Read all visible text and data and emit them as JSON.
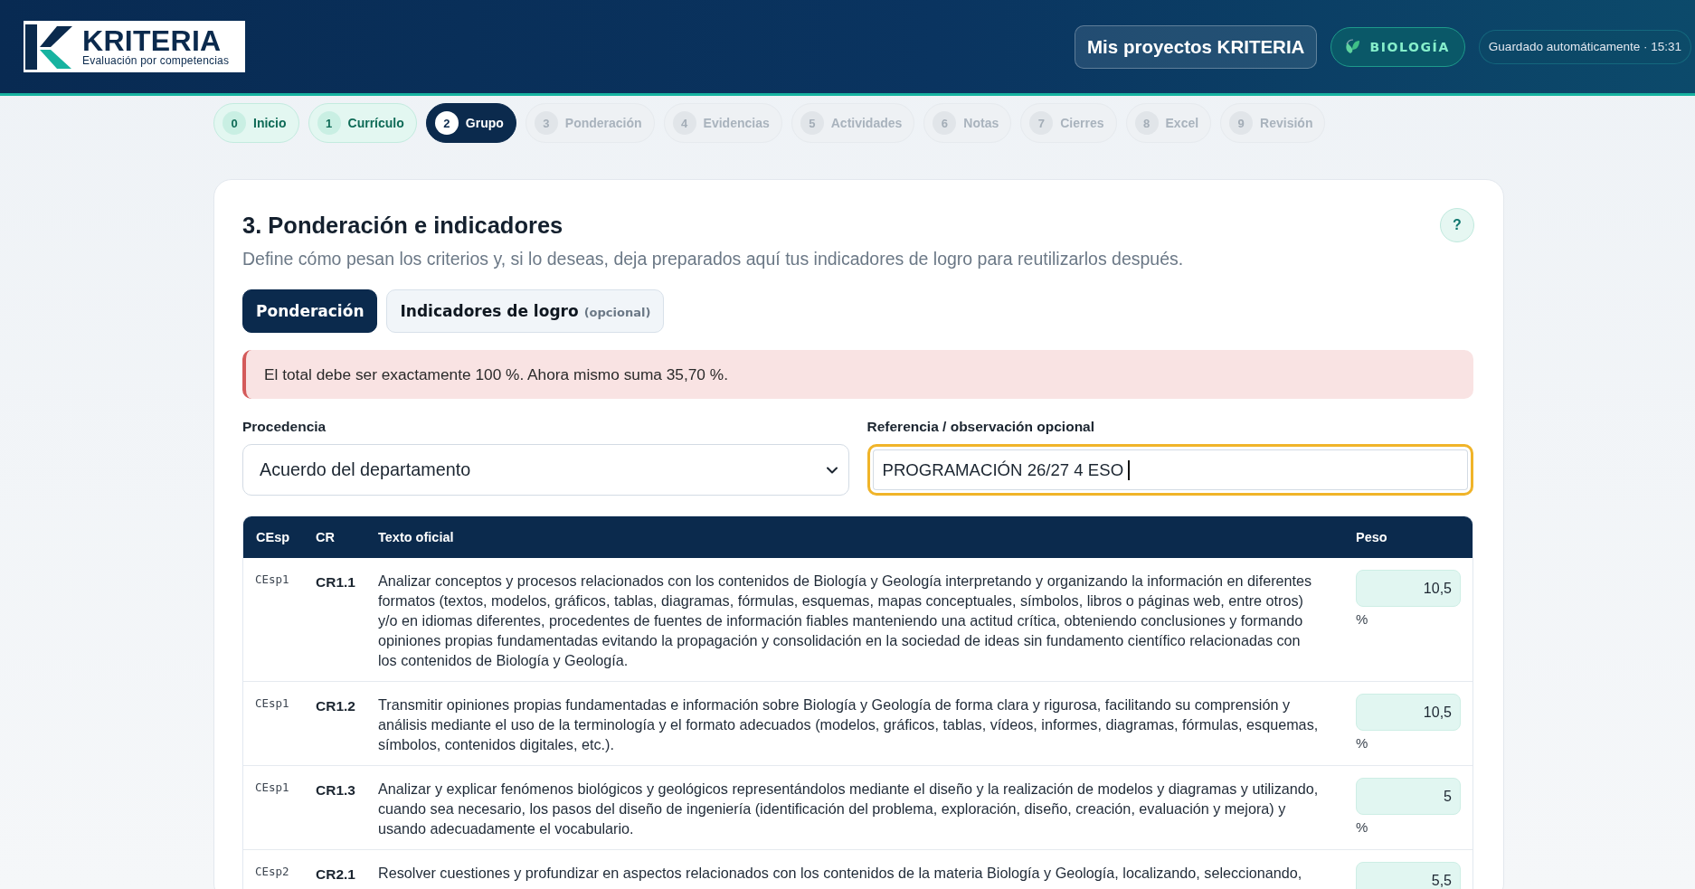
{
  "header": {
    "logo": {
      "wordmark": "KRITERIA",
      "tagline": "Evaluación por competencias"
    },
    "projects_button": "Mis proyectos KRITERIA",
    "subject_badge": "BIOLOGÍA",
    "autosave": "Guardado automáticamente · 15:31"
  },
  "stepper": [
    {
      "number": "0",
      "label": "Inicio",
      "completed": true,
      "selected": false
    },
    {
      "number": "1",
      "label": "Currículo",
      "completed": true,
      "selected": false
    },
    {
      "number": "2",
      "label": "Grupo",
      "completed": false,
      "selected": true
    },
    {
      "number": "3",
      "label": "Ponderación",
      "completed": false,
      "selected": false
    },
    {
      "number": "4",
      "label": "Evidencias",
      "completed": false,
      "selected": false
    },
    {
      "number": "5",
      "label": "Actividades",
      "completed": false,
      "selected": false
    },
    {
      "number": "6",
      "label": "Notas",
      "completed": false,
      "selected": false
    },
    {
      "number": "7",
      "label": "Cierres",
      "completed": false,
      "selected": false
    },
    {
      "number": "8",
      "label": "Excel",
      "completed": false,
      "selected": false
    },
    {
      "number": "9",
      "label": "Revisión",
      "completed": false,
      "selected": false
    }
  ],
  "section": {
    "title": "3. Ponderación e indicadores",
    "help_button": "?",
    "subtitle": "Define cómo pesan los criterios y, si lo deseas, deja preparados aquí tus indicadores de logro para reutilizarlos después.",
    "tabs": [
      {
        "label": "Ponderación",
        "selected": true
      },
      {
        "label": "Indicadores de logro",
        "note": "(opcional)",
        "selected": false
      }
    ],
    "alert": {
      "kind": "error",
      "text": "El total debe ser exactamente 100 %. Ahora mismo suma 35,70 %."
    },
    "fields": [
      {
        "kind": "select",
        "label": "Procedencia",
        "value": "Acuerdo del departamento",
        "focused": false
      },
      {
        "kind": "text",
        "label": "Referencia / observación opcional",
        "value": "PROGRAMACIÓN 26/27 4 ESO",
        "focused": true
      }
    ],
    "table": {
      "columns": [
        "CEsp",
        "CR",
        "Texto oficial",
        "Peso"
      ],
      "rows": [
        {
          "cesp": "CEsp1",
          "cr": "CR1.1",
          "text": "Analizar conceptos y procesos relacionados con los contenidos de Biología y Geología interpretando y organizando la información en diferentes formatos (textos, modelos, gráficos, tablas, diagramas, fórmulas, esquemas, mapas conceptuales, símbolos, libros o páginas web, entre otros) y/o en idiomas diferentes, procedentes de fuentes de información fiables manteniendo una actitud crítica, obteniendo conclusiones y formando opiniones propias fundamentadas evitando la propagación y consolidación en la sociedad de ideas sin fundamento científico relacionadas con los contenidos de Biología y Geología.",
          "weight": "10,5",
          "unit": "%"
        },
        {
          "cesp": "CEsp1",
          "cr": "CR1.2",
          "text": "Transmitir opiniones propias fundamentadas e información sobre Biología y Geología de forma clara y rigurosa, facilitando su comprensión y análisis mediante el uso de la terminología y el formato adecuados (modelos, gráficos, tablas, vídeos, informes, diagramas, fórmulas, esquemas, símbolos, contenidos digitales, etc.).",
          "weight": "10,5",
          "unit": "%"
        },
        {
          "cesp": "CEsp1",
          "cr": "CR1.3",
          "text": "Analizar y explicar fenómenos biológicos y geológicos representándolos mediante el diseño y la realización de modelos y diagramas y utilizando, cuando sea necesario, los pasos del diseño de ingeniería (identificación del problema, exploración, diseño, creación, evaluación y mejora) y usando adecuadamente el vocabulario.",
          "weight": "5",
          "unit": "%"
        },
        {
          "cesp": "CEsp2",
          "cr": "CR2.1",
          "text": "Resolver cuestiones y profundizar en aspectos relacionados con los contenidos de la materia Biología y Geología, localizando, seleccionando,",
          "weight": "5,5"
        }
      ]
    }
  }
}
